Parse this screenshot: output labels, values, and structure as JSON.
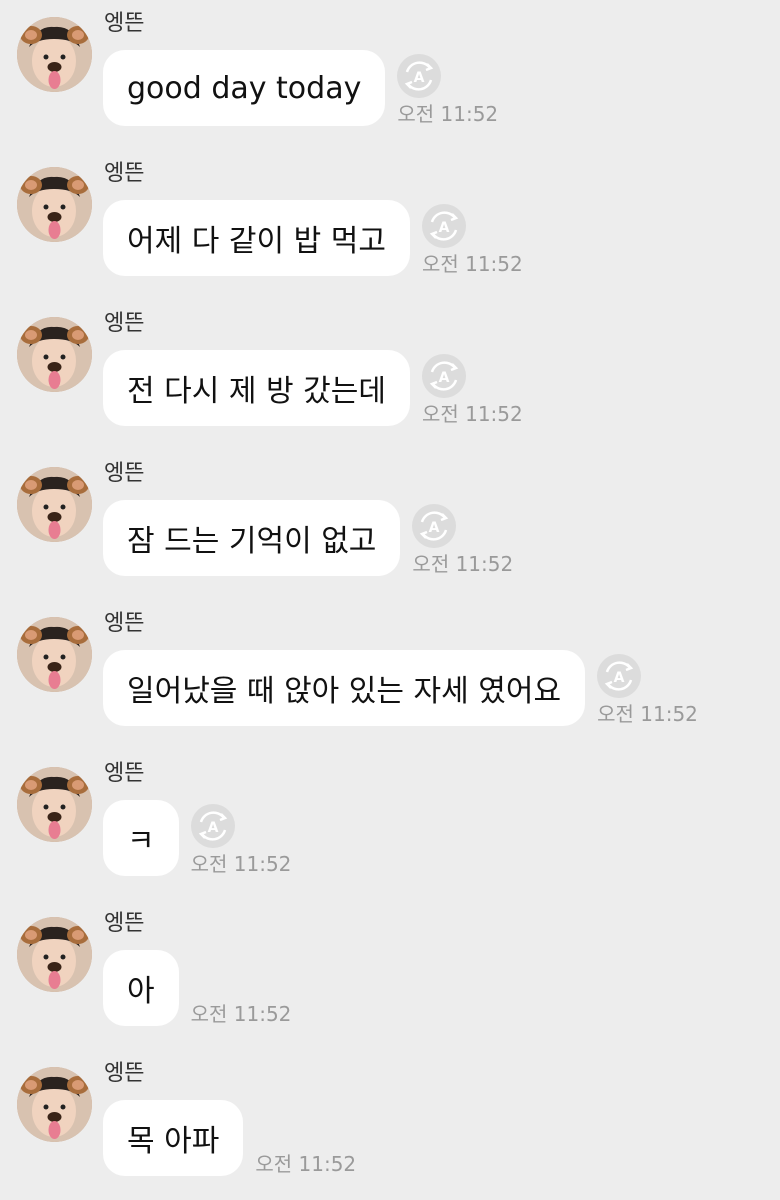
{
  "sender": "엥뜬",
  "icons": {
    "avatar": "dog-filter-selfie-avatar",
    "translate": "auto-translate-icon"
  },
  "messages": [
    {
      "text": "good day today",
      "time": "오전 11:52",
      "translate_icon": true
    },
    {
      "text": "어제 다 같이 밥 먹고",
      "time": "오전 11:52",
      "translate_icon": true
    },
    {
      "text": "전 다시 제 방 갔는데",
      "time": "오전 11:52",
      "translate_icon": true
    },
    {
      "text": "잠 드는 기억이 없고",
      "time": "오전 11:52",
      "translate_icon": true
    },
    {
      "text": "일어났을 때 앉아 있는 자세 였어요",
      "time": "오전 11:52",
      "translate_icon": true
    },
    {
      "text": "ㅋ",
      "time": "오전 11:52",
      "translate_icon": true
    },
    {
      "text": "아",
      "time": "오전 11:52",
      "translate_icon": false
    },
    {
      "text": "목 아파",
      "time": "오전 11:52",
      "translate_icon": false
    }
  ],
  "colors": {
    "background": "#ededed",
    "bubble": "#ffffff",
    "timestamp": "#9a9a9a",
    "translate_icon_bg": "#dcdcdc"
  }
}
